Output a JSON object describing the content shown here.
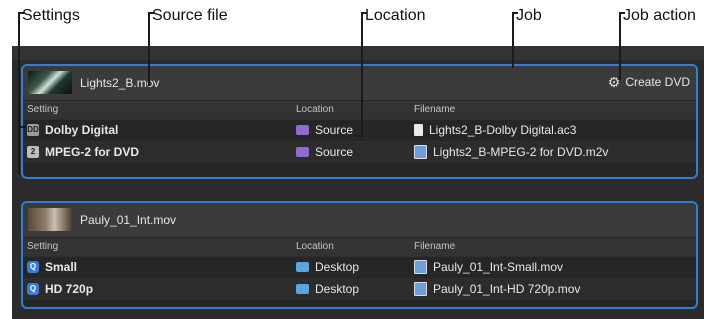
{
  "callouts": {
    "settings": "Settings",
    "source_file": "Source file",
    "location": "Location",
    "job": "Job",
    "job_action": "Job action"
  },
  "columns": {
    "setting": "Setting",
    "location": "Location",
    "filename": "Filename"
  },
  "jobs": [
    {
      "source": "Lights2_B.mov",
      "action_label": "Create DVD",
      "action_icon": "gear-icon",
      "rows": [
        {
          "setting": "Dolby Digital",
          "setting_icon": "DD",
          "location": "Source",
          "filename": "Lights2_B-Dolby Digital.ac3"
        },
        {
          "setting": "MPEG-2 for DVD",
          "setting_icon": "2",
          "location": "Source",
          "filename": "Lights2_B-MPEG-2 for DVD.m2v"
        }
      ]
    },
    {
      "source": "Pauly_01_Int.mov",
      "rows": [
        {
          "setting": "Small",
          "setting_icon": "quicktime-icon",
          "location": "Desktop",
          "filename": "Pauly_01_Int-Small.mov"
        },
        {
          "setting": "HD 720p",
          "setting_icon": "quicktime-icon",
          "location": "Desktop",
          "filename": "Pauly_01_Int-HD 720p.mov"
        }
      ]
    }
  ],
  "colors": {
    "accent": "#2f7fd8",
    "panel_bg": "#2b2b2b",
    "source_folder": "#8f6ad0",
    "desktop_folder": "#5ca6e0"
  }
}
